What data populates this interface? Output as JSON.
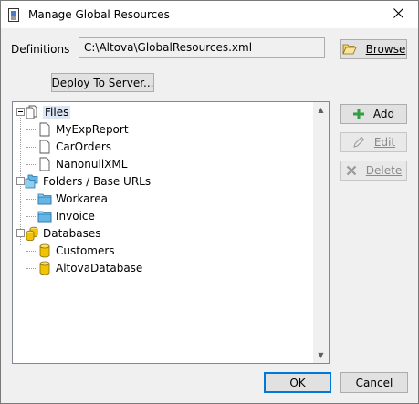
{
  "window": {
    "title": "Manage Global Resources",
    "icon": "document-icon",
    "close_icon": "close-icon"
  },
  "definitions": {
    "label": "Definitions",
    "path": "C:\\Altova\\GlobalResources.xml"
  },
  "buttons": {
    "browse": "Browse",
    "deploy": "Deploy To Server...",
    "add": "Add",
    "edit": "Edit",
    "delete": "Delete",
    "ok": "OK",
    "cancel": "Cancel"
  },
  "tree": {
    "files": {
      "label": "Files",
      "items": [
        "MyExpReport",
        "CarOrders",
        "NanonullXML"
      ]
    },
    "folders": {
      "label": "Folders / Base URLs",
      "items": [
        "Workarea",
        "Invoice"
      ]
    },
    "databases": {
      "label": "Databases",
      "items": [
        "Customers",
        "AltovaDatabase"
      ]
    }
  },
  "colors": {
    "accent": "#0078d7",
    "folder": "#62b7e9",
    "database": "#f2c300",
    "add": "#2ea043"
  }
}
